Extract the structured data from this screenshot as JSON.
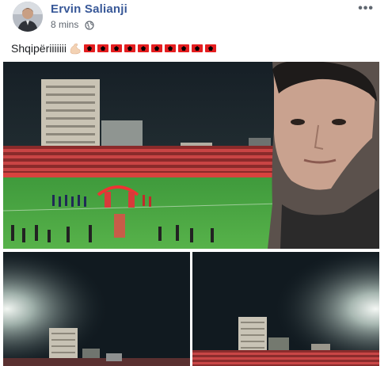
{
  "post": {
    "author": "Ervin Salianji",
    "time": "8 mins",
    "privacy_icon": "globe-icon",
    "more_icon": "more-options-icon",
    "text": "Shqipëriiiiiii",
    "emoji": [
      "flexed-biceps",
      "albanian-flag"
    ],
    "flag_count": 10,
    "photos": [
      {
        "name": "stadium-selfie-photo",
        "content": "stadium-selfie"
      },
      {
        "name": "stadium-night-photo-1",
        "content": "night-sky-building"
      },
      {
        "name": "stadium-night-photo-2",
        "content": "night-sky-building-stands"
      }
    ]
  },
  "colors": {
    "author_link": "#385898",
    "meta_text": "#606770",
    "flag_red": "#e41e20",
    "flag_black": "#000000"
  }
}
